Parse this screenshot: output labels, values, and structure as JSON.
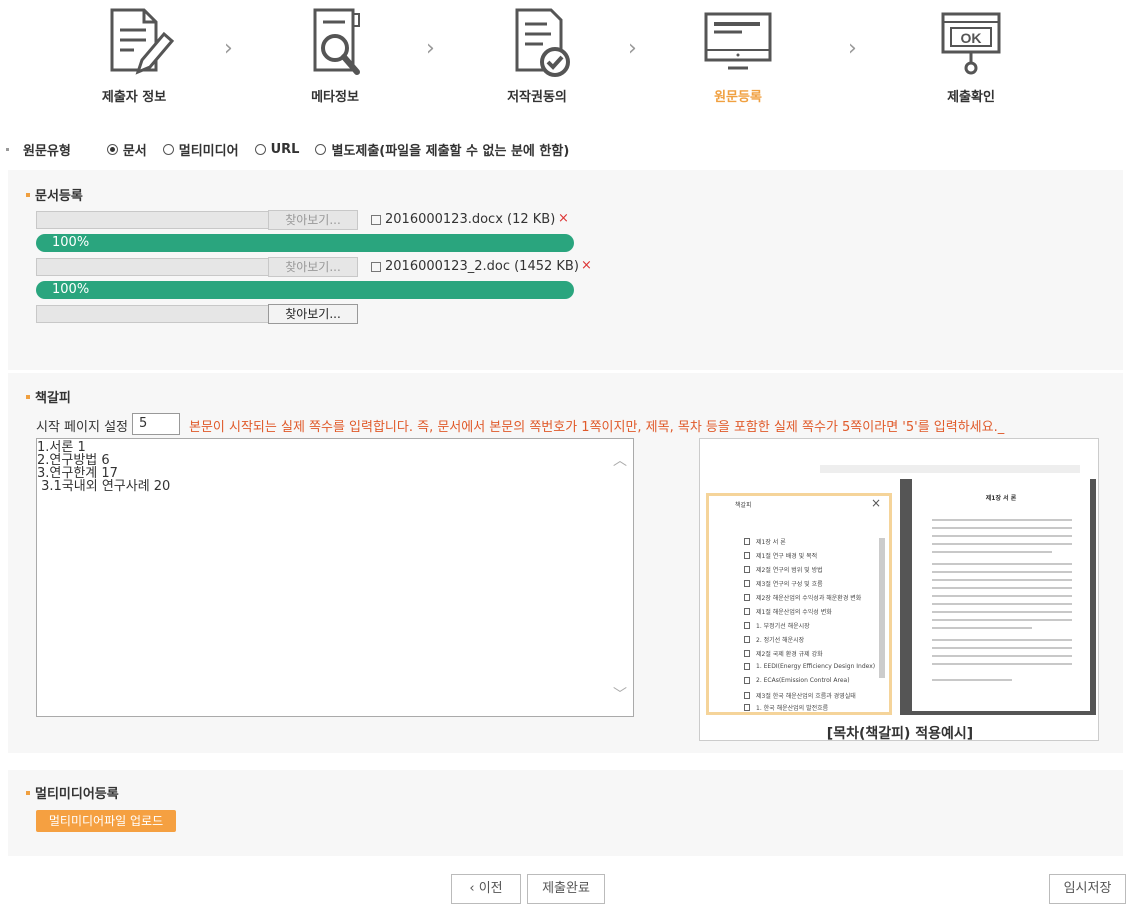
{
  "steps": [
    {
      "label": "제출자 정보",
      "icon": "document-pen-icon",
      "active": false
    },
    {
      "label": "메타정보",
      "icon": "document-search-icon",
      "active": false
    },
    {
      "label": "저작권동의",
      "icon": "document-check-icon",
      "active": false
    },
    {
      "label": "원문등록",
      "icon": "monitor-icon",
      "active": true
    },
    {
      "label": "제출확인",
      "icon": "ok-stamp-icon",
      "active": false
    }
  ],
  "stamp_text": "OK",
  "step_separator": "›",
  "source_type": {
    "title": "원문유형",
    "options": [
      {
        "label": "문서",
        "selected": true
      },
      {
        "label": "멀티미디어",
        "selected": false
      },
      {
        "label": "URL",
        "selected": false
      },
      {
        "label": "별도제출(파일을 제출할 수 없는 분에 한함)",
        "selected": false
      }
    ]
  },
  "document_section": {
    "title": "문서등록",
    "browse_label": "찾아보기...",
    "files": [
      {
        "name": "2016000123.docx (12 KB)",
        "progress_text": "100%",
        "progress": 100
      },
      {
        "name": "2016000123_2.doc (1452 KB)",
        "progress_text": "100%",
        "progress": 100
      }
    ],
    "delete_label": "×"
  },
  "bookmark_section": {
    "title": "책갈피",
    "start_page_label": "시작 페이지 설정",
    "start_page_value": "5",
    "instruction": "본문이 시작되는 실제 쪽수를 입력합니다. 즉, 문서에서 본문의 쪽번호가 1쪽이지만, 제목, 목차 등을 포함한 실제 쪽수가 5쪽이라면 '5'를 입력하세요._",
    "toc_lines": [
      "1.서론 1",
      "2.연구방법 6",
      "3.연구한계 17",
      " 3.1국내외 연구사례 20"
    ],
    "preview_caption": "[목차(책갈피) 적용예시]",
    "preview_panel_title": "책갈피",
    "preview_items": [
      "제1장 서 론",
      "제1절 연구 배경 및 목적",
      "제2절 연구의 범위 및 방법",
      "제3절 연구의 구성 및 흐름",
      "제2장 해운산업의 수익성과 해운환경 변화",
      "제1절 해운산업의 수익성 변화",
      "1. 부정기선 해운시장",
      "2. 정기선 해운시장",
      "제2절 국제 환경 규제 강화",
      "1. EEDI(Energy Efficiency Design Index)",
      "2. ECAs(Emission Control Area)",
      "제3절 한국 해운산업의 흐름과 경영실태",
      "1. 한국 해운산업의 발전흐름"
    ],
    "preview_doc_heading": "제1장 서 론"
  },
  "multimedia_section": {
    "title": "멀티미디어등록",
    "upload_label": "멀티미디어파일 업로드"
  },
  "footer": {
    "prev_label": "‹ 이전",
    "submit_label": "제출완료",
    "temp_save_label": "임시저장"
  },
  "colors": {
    "accent": "#f0a040",
    "progress": "#2aa57e",
    "warn": "#e05a2a",
    "delete": "#dd3333"
  }
}
